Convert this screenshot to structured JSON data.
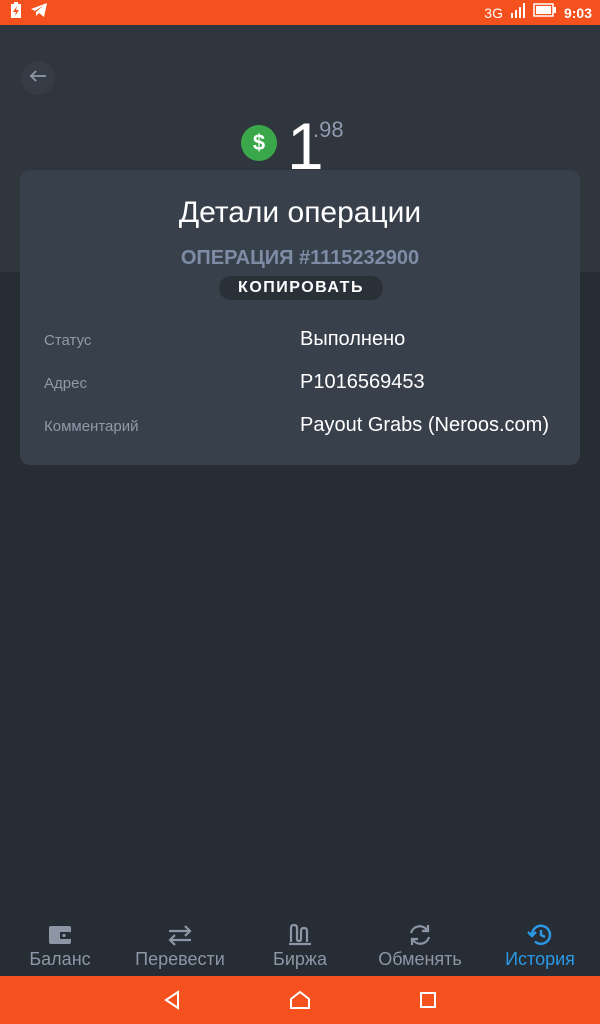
{
  "status_bar": {
    "network": "3G",
    "time": "9:03"
  },
  "header": {
    "back_icon": "arrow-left-icon",
    "currency_icon": "dollar-icon",
    "amount_int": "1",
    "amount_frac": ".98"
  },
  "card": {
    "title": "Детали операции",
    "operation_id": "ОПЕРАЦИЯ #1115232900",
    "copy_label": "КОПИРОВАТЬ",
    "rows": [
      {
        "key": "Статус",
        "value": "Выполнено"
      },
      {
        "key": "Адрес",
        "value": "P1016569453"
      },
      {
        "key": "Комментарий",
        "value": "Payout Grabs (Neroos.com)"
      }
    ]
  },
  "bottom_nav": {
    "items": [
      {
        "label": "Баланс",
        "icon": "wallet-icon"
      },
      {
        "label": "Перевести",
        "icon": "transfer-icon"
      },
      {
        "label": "Биржа",
        "icon": "exchange-chart-icon"
      },
      {
        "label": "Обменять",
        "icon": "swap-icon"
      },
      {
        "label": "История",
        "icon": "history-icon"
      }
    ],
    "active_index": 4,
    "active_color": "#2b99e6"
  },
  "colors": {
    "status_bar": "#f4511e",
    "background": "#272d35",
    "card": "#38414b",
    "accent_green": "#3aa84a"
  }
}
